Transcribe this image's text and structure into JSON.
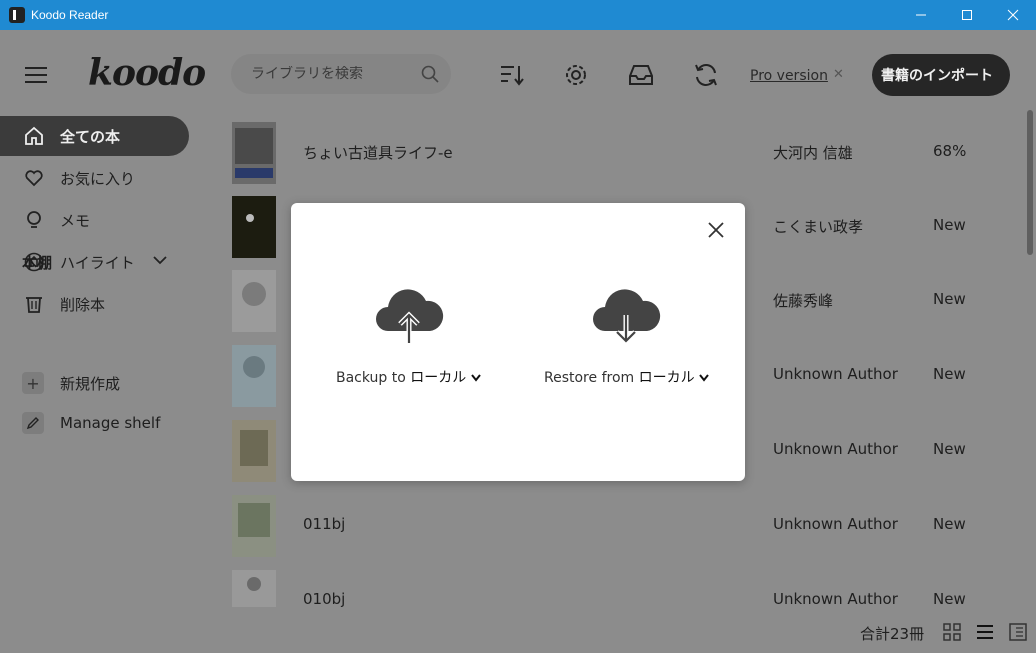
{
  "window": {
    "title": "Koodo Reader",
    "minimize_icon": "minimize-icon",
    "maximize_icon": "maximize-icon",
    "close_icon": "close-icon"
  },
  "header": {
    "logo": "koodo",
    "search_placeholder": "ライブラリを検索",
    "pro_label": "Pro version",
    "import_label": "書籍のインポート"
  },
  "sidebar": {
    "items": [
      {
        "label": "全ての本",
        "icon": "home-icon"
      },
      {
        "label": "お気に入り",
        "icon": "heart-icon"
      },
      {
        "label": "メモ",
        "icon": "bulb-icon"
      },
      {
        "label": "ハイライト",
        "icon": "highlight-icon"
      },
      {
        "label": "削除本",
        "icon": "trash-icon"
      }
    ],
    "shelf_title": "本棚",
    "new_shelf": "新規作成",
    "manage_shelf": "Manage shelf"
  },
  "books": [
    {
      "title": "ちょい古道具ライフ-e",
      "author": "大河内 信雄",
      "progress": "68%"
    },
    {
      "title": "",
      "author": "こくまい政孝",
      "progress": "New"
    },
    {
      "title": "",
      "author": "佐藤秀峰",
      "progress": "New"
    },
    {
      "title": "",
      "author": "Unknown Author",
      "progress": "New"
    },
    {
      "title": "",
      "author": "Unknown Author",
      "progress": "New"
    },
    {
      "title": "011bj",
      "author": "Unknown Author",
      "progress": "New"
    },
    {
      "title": "010bj",
      "author": "Unknown Author",
      "progress": "New"
    }
  ],
  "footer": {
    "count": "合計23冊"
  },
  "modal": {
    "backup_label": "Backup to",
    "backup_target": "ローカル",
    "restore_label": "Restore from",
    "restore_target": "ローカル"
  },
  "colors": {
    "titlebar": "#1f8ad2",
    "overlay": "#8c8c8c",
    "active_nav": "#3b3b3b",
    "cloud": "#444444"
  }
}
